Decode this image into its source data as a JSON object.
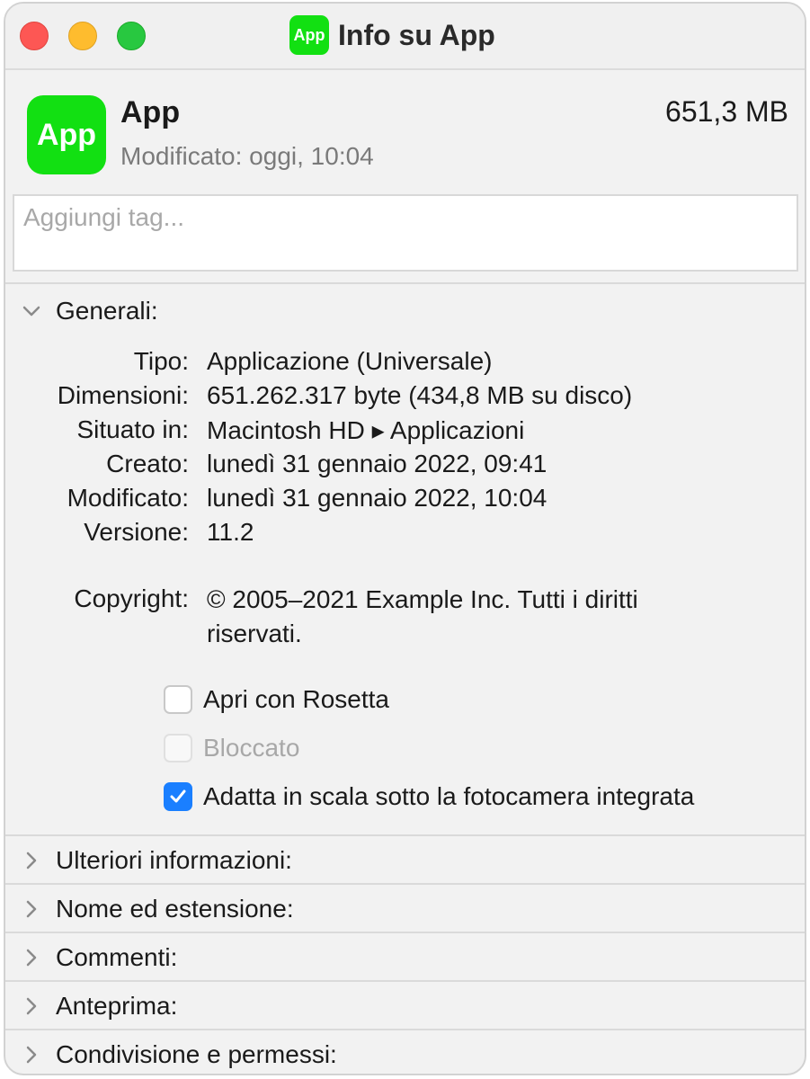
{
  "window": {
    "title": "Info su App",
    "title_icon_text": "App"
  },
  "header": {
    "icon_text": "App",
    "app_name": "App",
    "modified": "Modificato: oggi, 10:04",
    "size": "651,3 MB"
  },
  "tags": {
    "placeholder": "Aggiungi tag..."
  },
  "general": {
    "label": "Generali:",
    "expanded": true,
    "rows": [
      {
        "key": "Tipo:",
        "value": "Applicazione (Universale)"
      },
      {
        "key": "Dimensioni:",
        "value": "651.262.317 byte (434,8 MB su disco)"
      },
      {
        "key": "Situato in:",
        "value": "Macintosh HD ▸ Applicazioni"
      },
      {
        "key": "Creato:",
        "value": "lunedì 31 gennaio 2022, 09:41"
      },
      {
        "key": "Modificato:",
        "value": "lunedì 31 gennaio 2022, 10:04"
      },
      {
        "key": "Versione:",
        "value": "11.2"
      }
    ],
    "copyright_key": "Copyright:",
    "copyright_value": "© 2005–2021 Example Inc. Tutti i diritti riservati.",
    "checkboxes": [
      {
        "label": "Apri con Rosetta",
        "checked": false,
        "enabled": true
      },
      {
        "label": "Bloccato",
        "checked": false,
        "enabled": false
      },
      {
        "label": "Adatta in scala sotto la fotocamera integrata",
        "checked": true,
        "enabled": true
      }
    ]
  },
  "sections": [
    {
      "label": "Ulteriori informazioni:"
    },
    {
      "label": "Nome ed estensione:"
    },
    {
      "label": "Commenti:"
    },
    {
      "label": "Anteprima:"
    },
    {
      "label": "Condivisione e permessi:"
    }
  ],
  "colors": {
    "app_icon": "#12e012",
    "checkbox_checked": "#1a7fff",
    "traffic_close": "#fd5754",
    "traffic_minimize": "#febc2e",
    "traffic_maximize": "#28c840"
  },
  "icons": [
    "chevron-down-icon",
    "chevron-right-icon",
    "checkmark-icon",
    "path-arrow-icon"
  ]
}
